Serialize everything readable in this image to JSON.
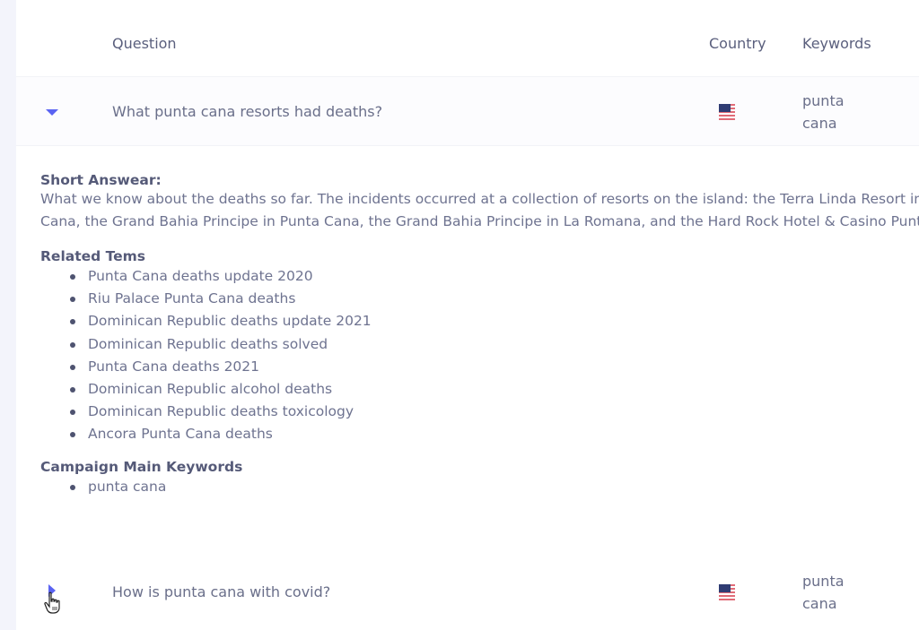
{
  "table": {
    "headers": {
      "question": "Question",
      "country": "Country",
      "keywords": "Keywords"
    },
    "rows": [
      {
        "expanded": true,
        "toggle_icon": "caret-down-icon",
        "question": "What punta cana resorts had deaths?",
        "country_flag": "us-flag-icon",
        "keywords_line1": "punta",
        "keywords_line2": "cana"
      },
      {
        "expanded": false,
        "toggle_icon": "caret-right-icon",
        "question": "How is punta cana with covid?",
        "country_flag": "us-flag-icon",
        "keywords_line1": "punta",
        "keywords_line2": "cana"
      }
    ]
  },
  "detail": {
    "short_answer_title": "Short Answear:",
    "short_answer_line1": "What we know about the deaths so far. The incidents occurred at a collection of resorts on the island: the Terra Linda Resort in Sosua, the Luxury Bahia Principe Bouganville in La Romana, the Excellence Punta",
    "short_answer_line2": "Cana, the Grand Bahia Principe in Punta Cana, the Grand Bahia Principe in La Romana, and the Hard Rock Hotel & Casino Punta Cana.",
    "related_title": "Related Tems",
    "related_terms": [
      "Punta Cana deaths update 2020",
      "Riu Palace Punta Cana deaths",
      "Dominican Republic deaths update 2021",
      "Dominican Republic deaths solved",
      "Punta Cana deaths 2021",
      "Dominican Republic alcohol deaths",
      "Dominican Republic deaths toxicology",
      "Ancora Punta Cana deaths"
    ],
    "campaign_title": "Campaign Main Keywords",
    "campaign_keywords": [
      "punta cana"
    ]
  },
  "colors": {
    "accent": "#5a63f2",
    "text": "#6e7390",
    "heading": "#555a78"
  }
}
